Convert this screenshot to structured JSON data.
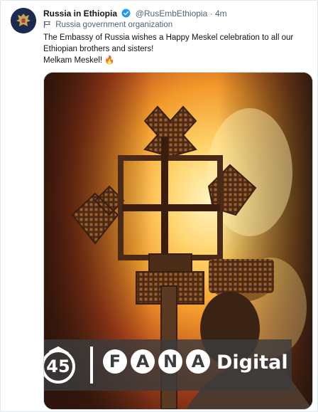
{
  "tweet": {
    "display_name": "Russia in Ethiopia",
    "handle": "@RusEmbEthiopia",
    "separator": "·",
    "time": "4m",
    "account_label": "Russia government organization",
    "text_lines": [
      "The Embassy of Russia wishes a Happy Meskel celebration to all our",
      "Ethiopian brothers and sisters!",
      "Melkam Meskel! 🔥"
    ]
  },
  "icons": {
    "verified": "verified-badge-icon",
    "label": "flag-icon",
    "avatar": "russian-emblem-avatar"
  },
  "media": {
    "watermark_letters": [
      "F",
      "A",
      "N",
      "A"
    ],
    "watermark_word": "Digital"
  },
  "colors": {
    "verified": "#1d9bf0",
    "secondary_text": "#536471",
    "avatar_bg": "#1b2a4e",
    "fire_orange": "#f39a2b"
  }
}
